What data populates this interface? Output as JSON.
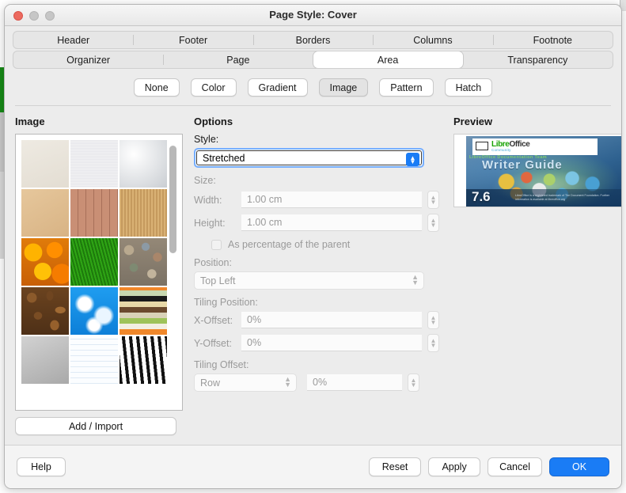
{
  "window": {
    "title": "Page Style: Cover",
    "traffic_lights": [
      "close",
      "minimize",
      "maximize"
    ]
  },
  "tabs": {
    "row1": [
      {
        "label": "Header",
        "selected": false
      },
      {
        "label": "Footer",
        "selected": false
      },
      {
        "label": "Borders",
        "selected": false
      },
      {
        "label": "Columns",
        "selected": false
      },
      {
        "label": "Footnote",
        "selected": false
      }
    ],
    "row2": [
      {
        "label": "Organizer",
        "selected": false
      },
      {
        "label": "Page",
        "selected": false
      },
      {
        "label": "Area",
        "selected": true
      },
      {
        "label": "Transparency",
        "selected": false
      }
    ]
  },
  "fill_types": [
    {
      "label": "None",
      "active": false
    },
    {
      "label": "Color",
      "active": false
    },
    {
      "label": "Gradient",
      "active": false
    },
    {
      "label": "Image",
      "active": true
    },
    {
      "label": "Pattern",
      "active": false
    },
    {
      "label": "Hatch",
      "active": false
    }
  ],
  "image_panel": {
    "heading": "Image",
    "add_import_label": "Add / Import",
    "scroll_thumb_percent": 40,
    "thumbnails": [
      {
        "name": "Painted White",
        "css": "linear-gradient(160deg,#eeeae2,#e3ddd2)"
      },
      {
        "name": "White Diffusion",
        "css": "repeating-linear-gradient(0deg,#f2f2f4 0 1px,#e7e7eb 1px 2px), linear-gradient(#f5f5f7,#e9e9ee)"
      },
      {
        "name": "Surface",
        "css": "radial-gradient(circle at 30% 30%,#ffffff,#c9cdd2), repeating-linear-gradient(45deg,#dfe2e6 0 3px,#cfd3d8 3px 6px)"
      },
      {
        "name": "Cardboard",
        "css": "linear-gradient(150deg,#e6c79c,#d8b384)"
      },
      {
        "name": "Studio",
        "css": "repeating-linear-gradient(90deg,#c98f75 0 9px,#a8705a 9px 10px), linear-gradient(#d09b80,#b5795f)"
      },
      {
        "name": "Fence",
        "css": "repeating-linear-gradient(90deg,#d9b174 0 2px,#c59a5e 2px 4px), repeating-linear-gradient(0deg,rgba(160,120,60,0.25) 0 2px,transparent 2px 5px)"
      },
      {
        "name": "Maple Leaves",
        "css": "radial-gradient(circle at 25% 30%,#ffb300 0 18%,transparent 19%), radial-gradient(circle at 70% 25%,#ff8f00 0 16%,transparent 17%), radial-gradient(circle at 45% 70%,#ffc107 0 20%,transparent 21%), radial-gradient(circle at 85% 75%,#f57c00 0 18%,transparent 19%), linear-gradient(#e07b0a,#c85f06)"
      },
      {
        "name": "Lawn",
        "css": "repeating-linear-gradient(75deg,#2fa515 0 2px,#1d7a0c 2px 4px), repeating-linear-gradient(-70deg,rgba(80,220,60,0.55) 0 2px,transparent 2px 5px)"
      },
      {
        "name": "Colorful Pebbles",
        "css": "radial-gradient(circle at 20% 25%,#b9a98f 0 9%,transparent 10%), radial-gradient(circle at 55% 18%,#8c9aa5 0 8%,transparent 9%), radial-gradient(circle at 80% 40%,#a9866a 0 9%,transparent 10%), radial-gradient(circle at 30% 62%,#7e8a72 0 9%,transparent 10%), radial-gradient(circle at 68% 75%,#c2b49c 0 9%,transparent 10%), linear-gradient(#948877,#7b7265)"
      },
      {
        "name": "Coffee Beans",
        "css": "radial-gradient(ellipse at 22% 22%,#8b5a2b 0 9%,transparent 10%), radial-gradient(ellipse at 60% 18%,#6f4520 0 8%,transparent 9%), radial-gradient(ellipse at 82% 48%,#a06a33 0 9%,transparent 10%), radial-gradient(ellipse at 35% 60%,#7a4d24 0 9%,transparent 10%), radial-gradient(ellipse at 70% 80%,#96602c 0 9%,transparent 10%), linear-gradient(#6b431f,#4e3017)"
      },
      {
        "name": "Little Clouds",
        "css": "radial-gradient(circle at 30% 35%,#ffffff 0 14%,transparent 22%), radial-gradient(circle at 70% 60%,#eaf6ff 0 16%,transparent 24%), radial-gradient(circle at 50% 80%,#ffffff 0 12%,transparent 20%), linear-gradient(#1f9df0,#0d7fd8)"
      },
      {
        "name": "Color Stripes",
        "css": "repeating-linear-gradient(0deg,#f0872a 0 7px,#f2efe3 7px 14px,#9ec35a 14px 21px,#d9d2b8 21px 28px,#6b4a2e 28px 35px,#e8d9a8 35px 42px,#1a1a1a 42px 49px,#c8d8b0 49px 56px), repeating-linear-gradient(90deg,rgba(255,255,255,0.55) 0 7px,rgba(0,0,0,0.05) 7px 14px)"
      },
      {
        "name": "Concrete",
        "css": "linear-gradient(155deg,#d2d2d2,#a9a9a9), repeating-linear-gradient(0deg,rgba(255,255,255,0.12) 0 3px,transparent 3px 6px)"
      },
      {
        "name": "Graph Paper",
        "css": "repeating-linear-gradient(0deg,#dfeaf5 0 1px,#fbfdff 1px 7px), repeating-linear-gradient(90deg,#dfeaf5 0 1px,#fbfdff 1px 7px)"
      },
      {
        "name": "Zebra",
        "css": "repeating-linear-gradient(84deg,#111111 0 4px,#ffffff 4px 9px), repeating-linear-gradient(96deg,rgba(0,0,0,0.5) 0 3px,transparent 3px 11px)"
      }
    ]
  },
  "options": {
    "heading": "Options",
    "style_label": "Style:",
    "style_value": "Stretched",
    "size_label": "Size:",
    "width_label": "Width:",
    "width_value": "1.00 cm",
    "height_label": "Height:",
    "height_value": "1.00 cm",
    "percent_parent_label": "As percentage of the parent",
    "percent_parent_checked": false,
    "position_label": "Position:",
    "position_value": "Top Left",
    "tiling_position_label": "Tiling Position:",
    "x_offset_label": "X-Offset:",
    "x_offset_value": "0%",
    "y_offset_label": "Y-Offset:",
    "y_offset_value": "0%",
    "tiling_offset_label": "Tiling Offset:",
    "tiling_offset_mode": "Row",
    "tiling_offset_value": "0%"
  },
  "preview": {
    "heading": "Preview",
    "cover": {
      "logo_primary": "Libre",
      "logo_secondary": "Office",
      "logo_tagline": "Community",
      "doc_team": "LibreOffice Documentation Team",
      "title": "Writer Guide",
      "version": "7.6",
      "footnote": "LibreOffice is a registered trademark of The Document Foundation. Further information is available at libreoffice.org"
    }
  },
  "footer": {
    "help": "Help",
    "reset": "Reset",
    "apply": "Apply",
    "cancel": "Cancel",
    "ok": "OK"
  },
  "colors": {
    "accent_blue": "#1a7cf5",
    "focus_ring": "#76aeff",
    "dialog_bg": "#ececec",
    "footer_bg": "#f4f4f4",
    "close_red": "#ec6a5f"
  }
}
